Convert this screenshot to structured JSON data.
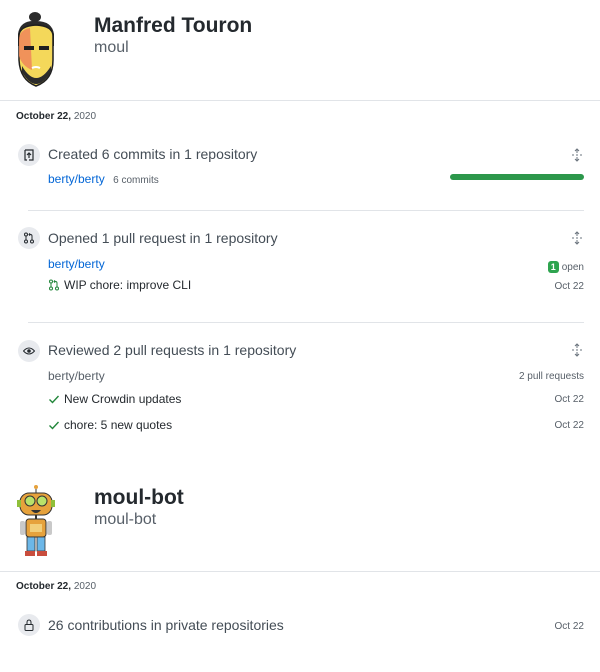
{
  "users": [
    {
      "name": "Manfred Touron",
      "login": "moul",
      "date": {
        "month_day": "October 22,",
        "year": "2020"
      },
      "activities": [
        {
          "title": "Created 6 commits in 1 repository",
          "repo": "berty/berty",
          "detail": "6 commits",
          "progress": 1.0
        },
        {
          "title": "Opened 1 pull request in 1 repository",
          "repo": "berty/berty",
          "badge_count": "1",
          "badge_label": "open",
          "pr_title": "WIP chore: improve CLI",
          "pr_date": "Oct 22"
        },
        {
          "title": "Reviewed 2 pull requests in 1 repository",
          "repo": "berty/berty",
          "count_label": "2 pull requests",
          "items": [
            {
              "title": "New Crowdin updates",
              "date": "Oct 22"
            },
            {
              "title": "chore: 5 new quotes",
              "date": "Oct 22"
            }
          ]
        }
      ]
    },
    {
      "name": "moul-bot",
      "login": "moul-bot",
      "date": {
        "month_day": "October 22,",
        "year": "2020"
      },
      "activities": [
        {
          "title": "26 contributions in private repositories",
          "date": "Oct 22"
        }
      ]
    }
  ],
  "colors": {
    "link": "#0366d6",
    "success": "#2c974b",
    "check": "#22863a",
    "badge": "#2ea44f"
  },
  "icons": [
    "repo-push-icon",
    "git-pull-request-icon",
    "eye-icon",
    "lock-icon",
    "check-icon",
    "unfold-icon"
  ]
}
